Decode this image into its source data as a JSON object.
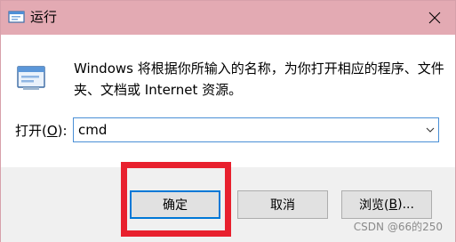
{
  "window": {
    "title": "运行",
    "close_icon": "close-icon",
    "titlebar_color": "#e3aab3"
  },
  "content": {
    "icon": "run-dialog-icon",
    "description": "Windows 将根据你所输入的名称，为你打开相应的程序、文件夹、文档或 Internet 资源。"
  },
  "open_field": {
    "label_before": "打开(",
    "label_hotkey": "O",
    "label_after": "):",
    "value": "cmd",
    "dropdown_icon": "chevron-down-icon"
  },
  "buttons": {
    "ok": "确定",
    "cancel": "取消",
    "browse_before": "浏览(",
    "browse_hotkey": "B",
    "browse_after": ")..."
  },
  "annotation": {
    "highlight_color": "#e8202e"
  },
  "watermark": "CSDN @66的250"
}
